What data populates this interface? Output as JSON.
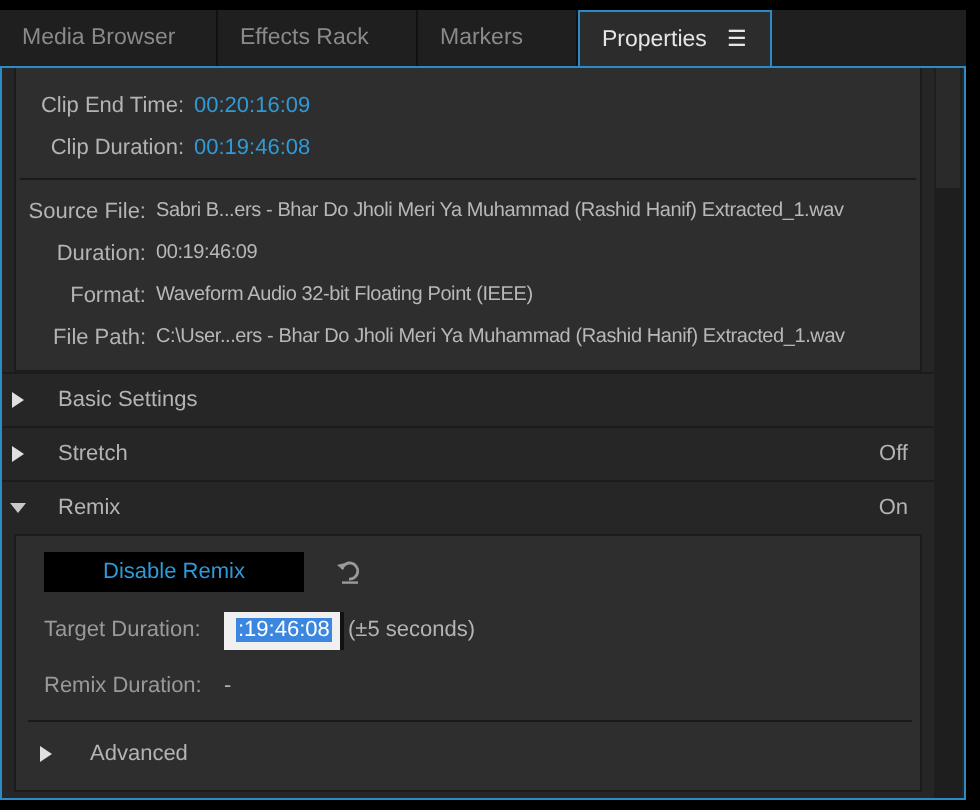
{
  "tabs": [
    {
      "label": "Media Browser",
      "selected": false
    },
    {
      "label": "Effects Rack",
      "selected": false
    },
    {
      "label": "Markers",
      "selected": false
    },
    {
      "label": "Properties",
      "selected": true,
      "menu": "☰"
    }
  ],
  "clip_info": [
    {
      "label": "Clip End Time:",
      "value": "00:20:16:09"
    },
    {
      "label": "Clip Duration:",
      "value": "00:19:46:08"
    }
  ],
  "file_info": [
    {
      "label": "Source File:",
      "value": "Sabri B...ers - Bhar Do Jholi Meri Ya Muhammad (Rashid Hanif) Extracted_1.wav"
    },
    {
      "label": "Duration:",
      "value": "00:19:46:09"
    },
    {
      "label": "Format:",
      "value": "Waveform Audio 32-bit Floating Point (IEEE)"
    },
    {
      "label": "File Path:",
      "value": "C:\\User...ers - Bhar Do Jholi Meri Ya Muhammad (Rashid Hanif) Extracted_1.wav"
    }
  ],
  "sections": [
    {
      "label": "Basic Settings",
      "expanded": false
    },
    {
      "label": "Stretch",
      "expanded": false,
      "value": "Off"
    },
    {
      "label": "Remix",
      "expanded": true,
      "value": "On"
    }
  ],
  "remix": {
    "button": "Disable Remix",
    "target_label": "Target Duration:",
    "target_value": ":19:46:08",
    "target_note": "(±5 seconds)",
    "remix_label": "Remix Duration:",
    "remix_value": "-",
    "advanced": {
      "label": "Advanced",
      "expanded": false
    }
  }
}
